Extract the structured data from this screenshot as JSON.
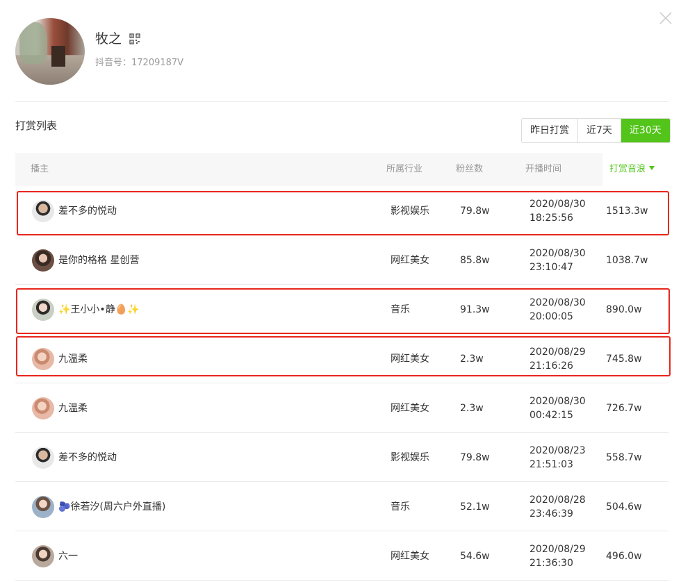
{
  "profile": {
    "name": "牧之",
    "id_label": "抖音号：",
    "id_value": "17209187V"
  },
  "section": {
    "title": "打赏列表"
  },
  "period_tabs": [
    {
      "label": "昨日打赏",
      "active": false
    },
    {
      "label": "近7天",
      "active": false
    },
    {
      "label": "近30天",
      "active": true
    }
  ],
  "table": {
    "headers": {
      "anchor": "播主",
      "industry": "所属行业",
      "fans": "粉丝数",
      "start_time": "开播时间",
      "reward": "打赏音浪"
    },
    "rows": [
      {
        "name": "差不多的悦动",
        "industry": "影视娱乐",
        "fans": "79.8w",
        "date": "2020/08/30",
        "clock": "18:25:56",
        "reward": "1513.3w",
        "highlighted": true
      },
      {
        "name": "是你的格格 星创营",
        "industry": "网红美女",
        "fans": "85.8w",
        "date": "2020/08/30",
        "clock": "23:10:47",
        "reward": "1038.7w",
        "highlighted": false
      },
      {
        "name": "✨王小小•静🥚✨",
        "industry": "音乐",
        "fans": "91.3w",
        "date": "2020/08/30",
        "clock": "20:00:05",
        "reward": "890.0w",
        "highlighted": true
      },
      {
        "name": "九温柔",
        "industry": "网红美女",
        "fans": "2.3w",
        "date": "2020/08/29",
        "clock": "21:16:26",
        "reward": "745.8w",
        "highlighted": true
      },
      {
        "name": "九温柔",
        "industry": "网红美女",
        "fans": "2.3w",
        "date": "2020/08/30",
        "clock": "00:42:15",
        "reward": "726.7w",
        "highlighted": false
      },
      {
        "name": "差不多的悦动",
        "industry": "影视娱乐",
        "fans": "79.8w",
        "date": "2020/08/23",
        "clock": "21:51:03",
        "reward": "558.7w",
        "highlighted": false
      },
      {
        "name": "🫐徐若汐(周六户外直播)",
        "industry": "音乐",
        "fans": "52.1w",
        "date": "2020/08/28",
        "clock": "23:46:39",
        "reward": "504.6w",
        "highlighted": false
      },
      {
        "name": "六一",
        "industry": "网红美女",
        "fans": "54.6w",
        "date": "2020/08/29",
        "clock": "21:36:30",
        "reward": "496.0w",
        "highlighted": false
      }
    ]
  },
  "colors": {
    "accent": "#52c41a",
    "highlight_border": "#e8261c",
    "header_bg": "#f7f7f7",
    "muted_text": "#999999"
  },
  "icons": {
    "close": "close-icon",
    "qr": "qr-code-icon",
    "sort": "sort-desc-icon"
  }
}
